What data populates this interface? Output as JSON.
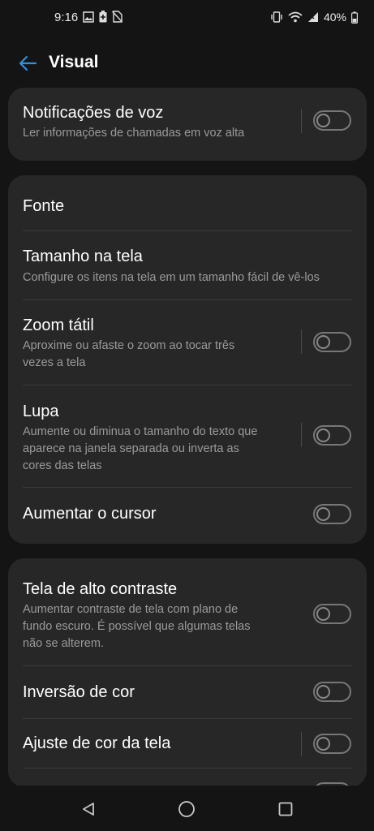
{
  "status": {
    "time": "9:16",
    "battery": "40%",
    "left_icons": [
      "image-icon",
      "battery-saver-icon",
      "no-sim-icon"
    ],
    "right_icons": [
      "vibrate-icon",
      "wifi-icon",
      "signal-icon",
      "battery-icon"
    ]
  },
  "header": {
    "title": "Visual",
    "back_icon": "back-arrow-icon"
  },
  "cards": [
    {
      "items": [
        {
          "title": "Notificações de voz",
          "subtitle": "Ler informações de chamadas em voz alta",
          "toggle": false
        }
      ]
    },
    {
      "items": [
        {
          "title": "Fonte"
        },
        {
          "title": "Tamanho na tela",
          "subtitle": "Configure os itens na tela em um tamanho fácil de vê-los"
        },
        {
          "title": "Zoom tátil",
          "subtitle": "Aproxime ou afaste o zoom ao tocar três\nvezes a tela",
          "toggle": false
        },
        {
          "title": "Lupa",
          "subtitle": "Aumente ou diminua o tamanho do texto que\naparece na janela separada ou inverta as\ncores das telas",
          "toggle": false
        },
        {
          "title": "Aumentar o cursor",
          "toggle": false
        }
      ]
    },
    {
      "items": [
        {
          "title": "Tela de alto contraste",
          "subtitle": "Aumentar contraste de tela com plano de\nfundo escuro. É possível que algumas telas\nnão se alterem.",
          "toggle": false
        },
        {
          "title": "Inversão de cor",
          "toggle": false
        },
        {
          "title": "Ajuste de cor da tela",
          "toggle": false
        }
      ]
    }
  ],
  "navigation": {
    "icons": [
      "back-triangle-icon",
      "home-circle-icon",
      "recents-square-icon"
    ]
  },
  "colors": {
    "accent": "#2f8fe0",
    "background": "#141414",
    "card": "#272727",
    "subtext": "#9a9a9a"
  }
}
